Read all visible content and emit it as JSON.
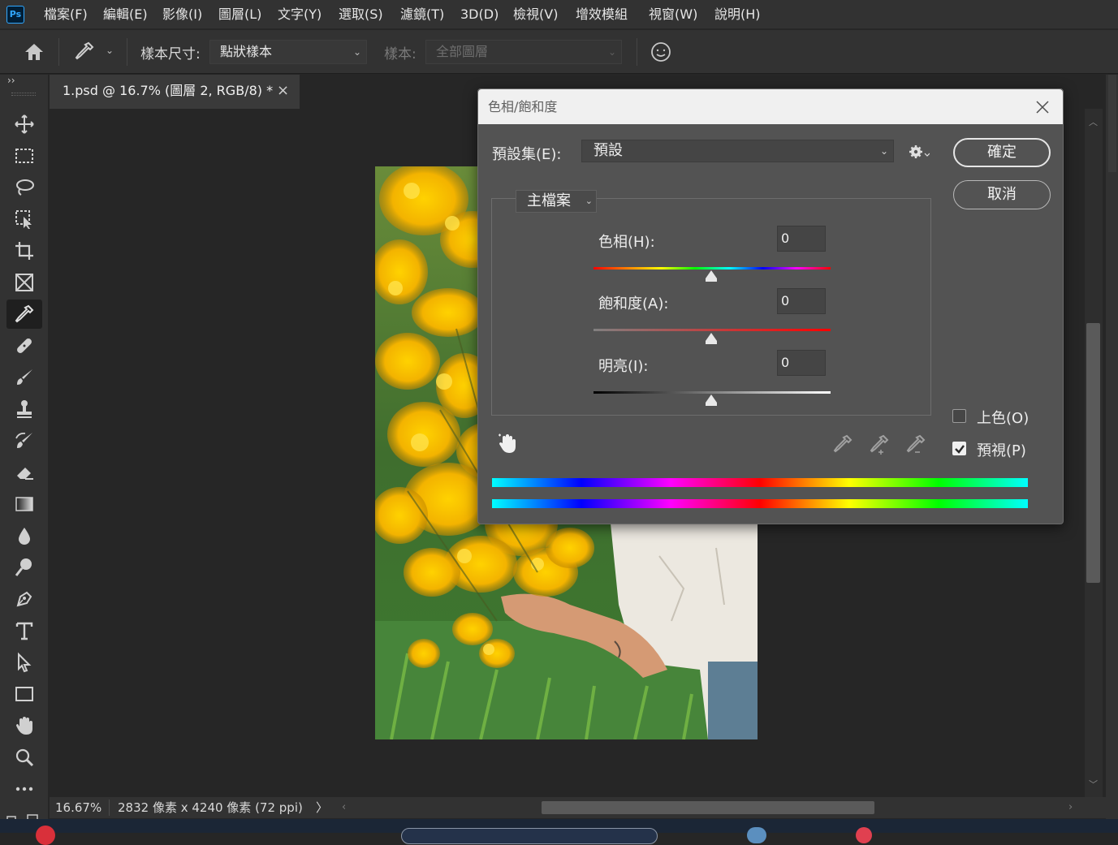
{
  "app": {
    "logo": "Ps"
  },
  "menu": [
    "檔案(F)",
    "編輯(E)",
    "影像(I)",
    "圖層(L)",
    "文字(Y)",
    "選取(S)",
    "濾鏡(T)",
    "3D(D)",
    "檢視(V)",
    "增效模組",
    "視窗(W)",
    "說明(H)"
  ],
  "options": {
    "sample_size_label": "樣本尺寸:",
    "sample_size_value": "點狀樣本",
    "sample_label": "樣本:",
    "sample_value": "全部圖層"
  },
  "panel_toggle": "››",
  "document": {
    "tab_title": "1.psd @ 16.7% (圖層 2, RGB/8) *",
    "close_glyph": "×"
  },
  "status": {
    "zoom": "16.67%",
    "info": "2832 像素 x 4240 像素 (72 ppi)",
    "arrow": "〉"
  },
  "dialog": {
    "title": "色相/飽和度",
    "preset_label": "預設集(E):",
    "preset_value": "預設",
    "ok_label": "確定",
    "cancel_label": "取消",
    "channel": "主檔案",
    "hue_label": "色相(H):",
    "hue_value": "0",
    "saturation_label": "飽和度(A):",
    "saturation_value": "0",
    "lightness_label": "明亮(I):",
    "lightness_value": "0",
    "colorize_label": "上色(O)",
    "colorize_checked": false,
    "preview_label": "預視(P)",
    "preview_checked": true
  },
  "tools": [
    "move-icon",
    "marquee-icon",
    "lasso-icon",
    "object-select-icon",
    "crop-icon",
    "frame-icon",
    "eyedropper-icon",
    "healing-icon",
    "brush-icon",
    "stamp-icon",
    "history-brush-icon",
    "eraser-icon",
    "gradient-icon",
    "blur-icon",
    "dodge-icon",
    "pen-icon",
    "type-icon",
    "path-select-icon",
    "rectangle-icon",
    "hand-icon",
    "zoom-icon",
    "more-icon"
  ],
  "selected_tool": "eyedropper-icon",
  "colors": {
    "accent": "#31a8ff",
    "ui_bg": "#323232",
    "canvas_bg": "#262626",
    "dialog_bg": "#535353"
  }
}
